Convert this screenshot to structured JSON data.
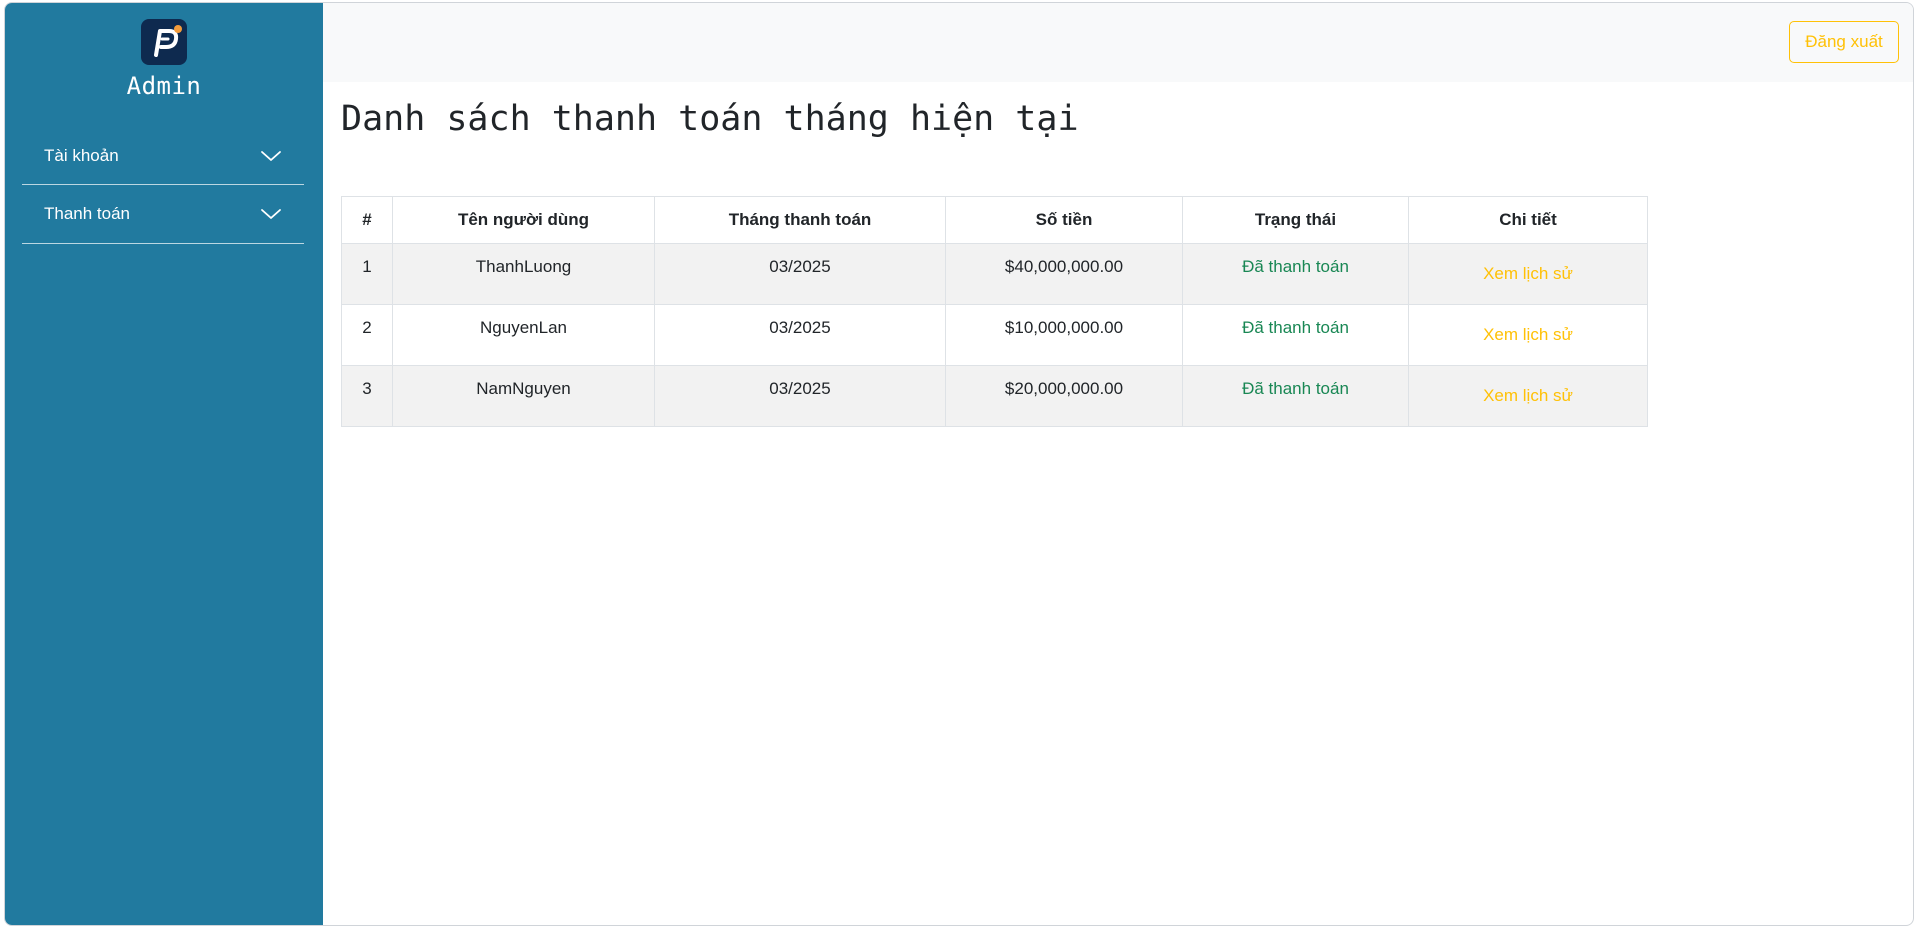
{
  "sidebar": {
    "brand": "Admin",
    "items": [
      {
        "label": "Tài khoản",
        "icon": "chevron-down-icon"
      },
      {
        "label": "Thanh toán",
        "icon": "chevron-down-icon"
      }
    ]
  },
  "header": {
    "logout_label": "Đăng xuất"
  },
  "main": {
    "title": "Danh sách thanh toán tháng hiện tại",
    "table": {
      "columns": [
        "#",
        "Tên người dùng",
        "Tháng thanh toán",
        "Số tiền",
        "Trạng thái",
        "Chi tiết"
      ],
      "rows": [
        {
          "index": "1",
          "user": "ThanhLuong",
          "month": "03/2025",
          "amount": "$40,000,000.00",
          "status": "Đã thanh toán",
          "action": "Xem lịch sử"
        },
        {
          "index": "2",
          "user": "NguyenLan",
          "month": "03/2025",
          "amount": "$10,000,000.00",
          "status": "Đã thanh toán",
          "action": "Xem lịch sử"
        },
        {
          "index": "3",
          "user": "NamNguyen",
          "month": "03/2025",
          "amount": "$20,000,000.00",
          "status": "Đã thanh toán",
          "action": "Xem lịch sử"
        }
      ]
    }
  },
  "colors": {
    "sidebar_bg": "#217a9f",
    "logout_accent": "#ffc107",
    "status_paid": "#198754",
    "link": "#ffc107"
  }
}
